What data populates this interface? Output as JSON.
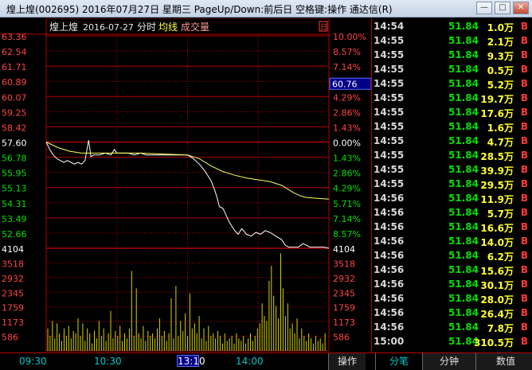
{
  "window": {
    "title": "煌上煌(002695) 2016年07月27日 星期三 PageUp/Down:前后日 空格键:操作 通达信(R)",
    "minimize": "—",
    "maximize": "□",
    "close": "✕"
  },
  "colors": {
    "up": "#ff3b3b",
    "down": "#00e000",
    "flat": "#ffffff",
    "avg": "#ffff55",
    "grid": "#b00000",
    "axis_text_up": "#ff4444",
    "axis_text_down": "#00e000",
    "volume": "#d4d400"
  },
  "chart_data": {
    "type": "line",
    "header": {
      "name": "煌上煌",
      "date": "2016-07-27",
      "mode": "分时",
      "avg_label": "均线",
      "vol_label": "成交量",
      "corner": "日"
    },
    "prev_close": 57.6,
    "ylim": [
      51.84,
      63.36
    ],
    "price_ticks": [
      "63.36",
      "62.54",
      "61.71",
      "60.89",
      "60.07",
      "59.25",
      "58.42",
      "57.60",
      "56.78",
      "55.95",
      "55.13",
      "54.31",
      "53.49",
      "52.66"
    ],
    "pct_ticks": [
      "10.00%",
      "8.57%",
      "7.14%",
      "5.71%",
      "4.29%",
      "2.86%",
      "1.43%",
      "0.00%",
      "1.43%",
      "2.86%",
      "4.29%",
      "5.71%",
      "7.14%",
      "8.57%"
    ],
    "price_cursor": "60.76",
    "vol_max_label": "4104",
    "vol_ticks": [
      "3518",
      "2932",
      "2345",
      "1759",
      "1173",
      "586"
    ],
    "x_ticks": [
      "09:30",
      "10:30",
      "13",
      "14:00"
    ],
    "x_cursor": "13:10",
    "price_line": [
      [
        0,
        57.6
      ],
      [
        3,
        57.2
      ],
      [
        6,
        56.9
      ],
      [
        9,
        56.7
      ],
      [
        12,
        56.6
      ],
      [
        15,
        56.5
      ],
      [
        18,
        56.6
      ],
      [
        21,
        56.5
      ],
      [
        24,
        56.4
      ],
      [
        27,
        56.5
      ],
      [
        30,
        56.4
      ],
      [
        33,
        56.6
      ],
      [
        36,
        57.7
      ],
      [
        38,
        56.8
      ],
      [
        40,
        56.9
      ],
      [
        45,
        56.9
      ],
      [
        50,
        57.0
      ],
      [
        55,
        56.9
      ],
      [
        58,
        57.2
      ],
      [
        60,
        57.0
      ],
      [
        65,
        57.0
      ],
      [
        70,
        57.0
      ],
      [
        75,
        56.9
      ],
      [
        80,
        57.0
      ],
      [
        85,
        56.9
      ],
      [
        90,
        56.9
      ],
      [
        95,
        56.9
      ],
      [
        100,
        56.9
      ],
      [
        105,
        56.9
      ],
      [
        110,
        56.9
      ],
      [
        115,
        56.9
      ],
      [
        120,
        56.9
      ],
      [
        125,
        56.7
      ],
      [
        130,
        56.4
      ],
      [
        135,
        56.0
      ],
      [
        140,
        55.5
      ],
      [
        143,
        55.0
      ],
      [
        145,
        54.6
      ],
      [
        147,
        54.1
      ],
      [
        150,
        54.0
      ],
      [
        153,
        53.6
      ],
      [
        155,
        53.3
      ],
      [
        158,
        53.0
      ],
      [
        160,
        52.8
      ],
      [
        163,
        52.6
      ],
      [
        166,
        52.9
      ],
      [
        170,
        52.6
      ],
      [
        174,
        52.5
      ],
      [
        178,
        52.7
      ],
      [
        182,
        52.6
      ],
      [
        186,
        52.8
      ],
      [
        190,
        52.7
      ],
      [
        195,
        52.5
      ],
      [
        200,
        52.3
      ],
      [
        203,
        52.0
      ],
      [
        206,
        51.9
      ],
      [
        210,
        51.9
      ],
      [
        214,
        51.9
      ],
      [
        218,
        52.1
      ],
      [
        221,
        52.0
      ],
      [
        224,
        51.9
      ],
      [
        228,
        51.9
      ],
      [
        232,
        51.9
      ],
      [
        236,
        51.9
      ],
      [
        240,
        51.84
      ]
    ],
    "avg_line": [
      [
        0,
        57.6
      ],
      [
        10,
        57.3
      ],
      [
        20,
        57.1
      ],
      [
        30,
        57.0
      ],
      [
        40,
        57.0
      ],
      [
        60,
        57.0
      ],
      [
        80,
        57.0
      ],
      [
        100,
        56.95
      ],
      [
        120,
        56.9
      ],
      [
        130,
        56.7
      ],
      [
        140,
        56.3
      ],
      [
        150,
        56.0
      ],
      [
        160,
        55.8
      ],
      [
        170,
        55.65
      ],
      [
        180,
        55.55
      ],
      [
        190,
        55.45
      ],
      [
        200,
        55.25
      ],
      [
        205,
        55.05
      ],
      [
        210,
        54.85
      ],
      [
        215,
        54.7
      ],
      [
        220,
        54.6
      ],
      [
        230,
        54.55
      ],
      [
        240,
        54.5
      ]
    ],
    "volume": [
      900,
      600,
      1200,
      500,
      1100,
      700,
      400,
      900,
      600,
      1000,
      500,
      800,
      700,
      1300,
      600,
      1100,
      400,
      900,
      700,
      300,
      800,
      500,
      1200,
      600,
      900,
      400,
      700,
      1600,
      500,
      800,
      600,
      1000,
      400,
      700,
      500,
      900,
      3200,
      600,
      2500,
      700,
      500,
      1000,
      400,
      800,
      600,
      700,
      500,
      900,
      1300,
      600,
      800,
      400,
      700,
      2100,
      500,
      2600,
      600,
      1200,
      800,
      1500,
      600,
      2300,
      900,
      1100,
      700,
      1400,
      500,
      900,
      400,
      1000,
      600,
      700,
      500,
      800,
      600,
      300,
      700,
      400,
      500,
      600,
      300,
      700,
      500,
      400,
      600,
      300,
      500,
      700,
      400,
      600,
      900,
      1100,
      1900,
      1400,
      1200,
      2800,
      3400,
      2200,
      1800,
      1300,
      3900,
      2500,
      1400,
      1900,
      900,
      1100,
      700,
      1300,
      500,
      900,
      600,
      400,
      700,
      500,
      300,
      600,
      400,
      500,
      300,
      700
    ]
  },
  "ticks": [
    {
      "time": "14:54",
      "price": "51.84",
      "vol": "1.0万",
      "flag": "B"
    },
    {
      "time": "14:55",
      "price": "51.84",
      "vol": "2.1万",
      "flag": "B"
    },
    {
      "time": "14:55",
      "price": "51.84",
      "vol": "9.3万",
      "flag": "B"
    },
    {
      "time": "14:55",
      "price": "51.84",
      "vol": "0.5万",
      "flag": "B"
    },
    {
      "time": "14:55",
      "price": "51.84",
      "vol": "5.2万",
      "flag": "B"
    },
    {
      "time": "14:55",
      "price": "51.84",
      "vol": "19.7万",
      "flag": "B"
    },
    {
      "time": "14:55",
      "price": "51.84",
      "vol": "17.6万",
      "flag": "B"
    },
    {
      "time": "14:55",
      "price": "51.84",
      "vol": "1.6万",
      "flag": "B"
    },
    {
      "time": "14:55",
      "price": "51.84",
      "vol": "4.7万",
      "flag": "B"
    },
    {
      "time": "14:55",
      "price": "51.84",
      "vol": "28.5万",
      "flag": "B"
    },
    {
      "time": "14:55",
      "price": "51.84",
      "vol": "39.9万",
      "flag": "B"
    },
    {
      "time": "14:55",
      "price": "51.84",
      "vol": "29.5万",
      "flag": "B"
    },
    {
      "time": "14:56",
      "price": "51.84",
      "vol": "11.9万",
      "flag": "B"
    },
    {
      "time": "14:56",
      "price": "51.84",
      "vol": "5.7万",
      "flag": "B"
    },
    {
      "time": "14:56",
      "price": "51.84",
      "vol": "16.6万",
      "flag": "B"
    },
    {
      "time": "14:56",
      "price": "51.84",
      "vol": "14.0万",
      "flag": "B"
    },
    {
      "time": "14:56",
      "price": "51.84",
      "vol": "6.2万",
      "flag": "B"
    },
    {
      "time": "14:56",
      "price": "51.84",
      "vol": "15.6万",
      "flag": "B"
    },
    {
      "time": "14:56",
      "price": "51.84",
      "vol": "30.1万",
      "flag": "B"
    },
    {
      "time": "14:56",
      "price": "51.84",
      "vol": "28.0万",
      "flag": "B"
    },
    {
      "time": "14:56",
      "price": "51.84",
      "vol": "26.4万",
      "flag": "B"
    },
    {
      "time": "14:56",
      "price": "51.84",
      "vol": "7.8万",
      "flag": "B"
    },
    {
      "time": "15:00",
      "price": "51.84",
      "vol": "310.5万",
      "flag": "B"
    }
  ],
  "bottom": {
    "left_labels": [
      "09:30",
      "10:30",
      "14:00"
    ],
    "tabs": [
      "操作",
      "分笔",
      "分钟",
      "数值"
    ],
    "active_tab": 1
  }
}
